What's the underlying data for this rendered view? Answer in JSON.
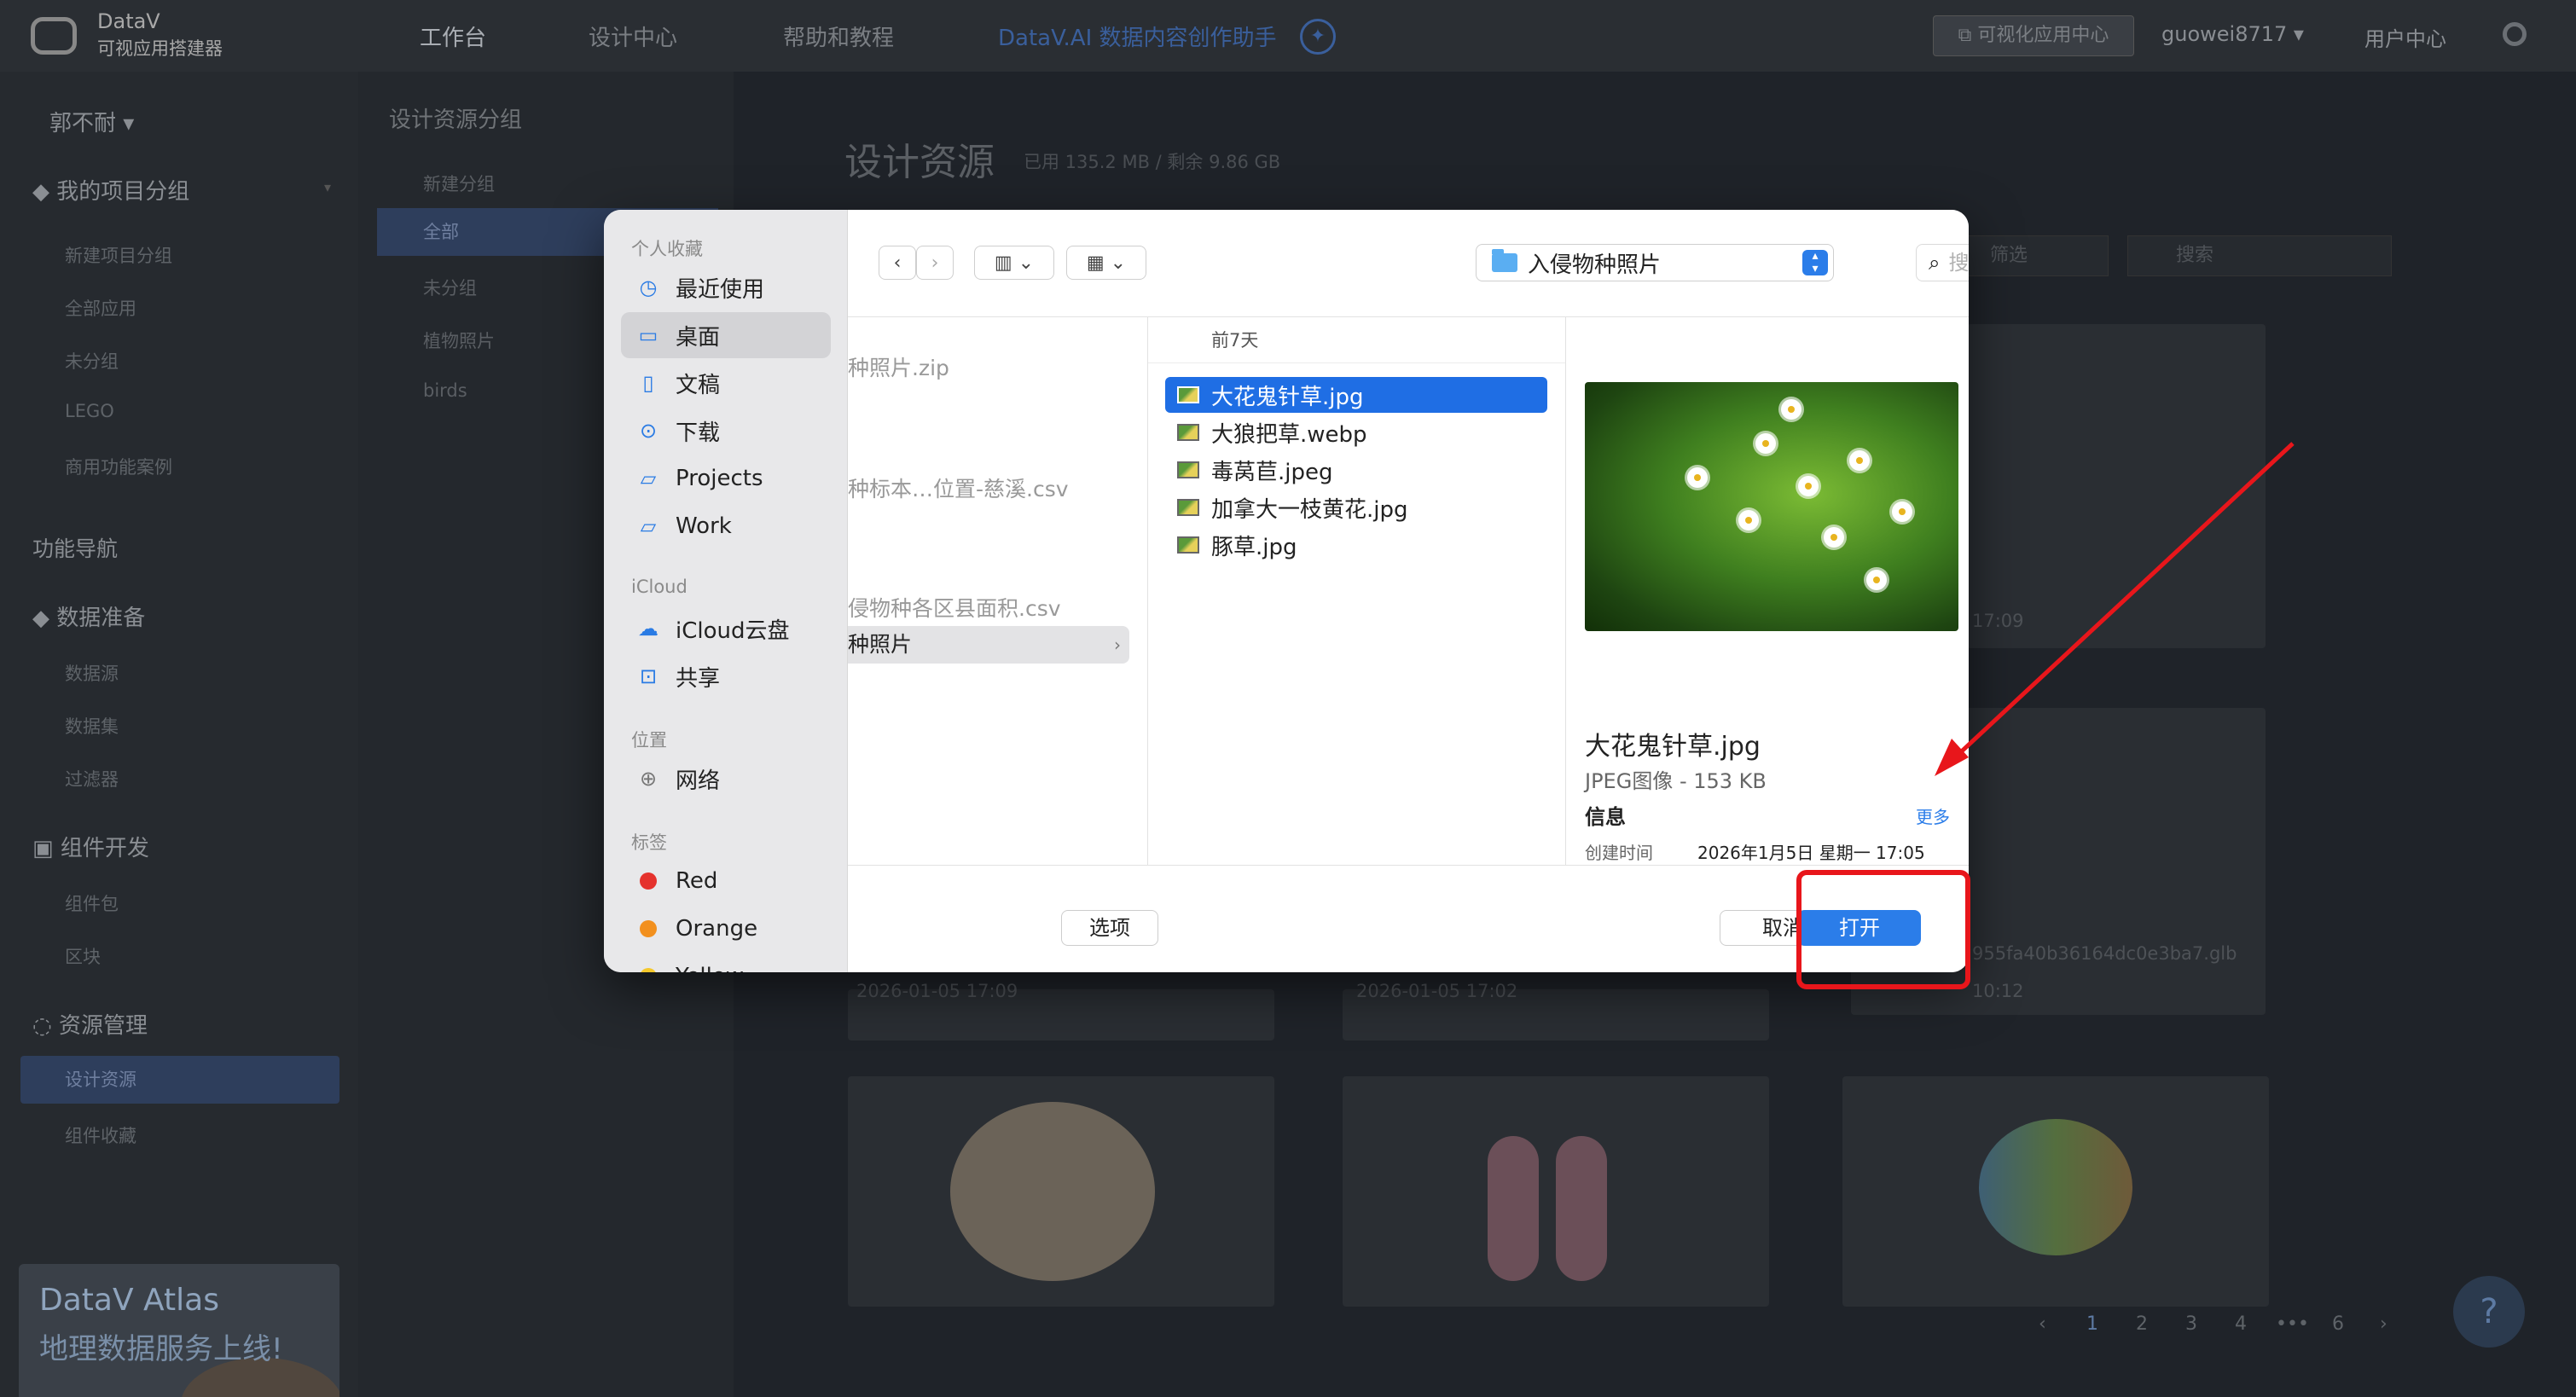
{
  "header": {
    "brand_line1": "DataV",
    "brand_line2": "可视应用搭建器",
    "nav": [
      "工作台",
      "设计中心",
      "帮助和教程",
      "DataV.AI 数据内容创作助手"
    ],
    "app_center": "可视化应用中心",
    "username": "guowei8717 ▾",
    "user_center": "用户中心"
  },
  "left_sidebar": {
    "user": "郭不耐 ▾",
    "project_group_title": "我的项目分组",
    "project_items": [
      "新建项目分组",
      "全部应用",
      "未分组",
      "LEGO",
      "商用功能案例"
    ],
    "function_nav": "功能导航",
    "data_prep": "数据准备",
    "data_items": [
      "数据源",
      "数据集",
      "过滤器"
    ],
    "component_dev": "组件开发",
    "component_items": [
      "组件包",
      "区块"
    ],
    "resource_mgmt": "资源管理",
    "resource_items": [
      "设计资源",
      "组件收藏"
    ],
    "promo_line1": "DataV Atlas",
    "promo_line2": "地理数据服务上线!"
  },
  "group_col": {
    "title": "设计资源分组",
    "items": [
      "新建分组",
      "全部",
      "未分组",
      "植物照片",
      "birds"
    ]
  },
  "main": {
    "title": "设计资源",
    "quota": "已用 135.2 MB / 剩余 9.86 GB",
    "filter": "筛选",
    "search_placeholder": "搜索",
    "card_dates": [
      "2026-01-05 17:09",
      "2026-01-05 17:02",
      "10:12"
    ],
    "card_file": "955fa40b36164dc0e3ba7.glb",
    "card_date_top": "17:09",
    "pages": [
      "1",
      "2",
      "3",
      "4",
      "•••",
      "6"
    ]
  },
  "dialog": {
    "sidebar": {
      "favorites_title": "个人收藏",
      "favorites": [
        {
          "label": "最近使用",
          "icon": "clock-icon"
        },
        {
          "label": "桌面",
          "icon": "desktop-icon"
        },
        {
          "label": "文稿",
          "icon": "document-icon"
        },
        {
          "label": "下载",
          "icon": "download-icon"
        },
        {
          "label": "Projects",
          "icon": "folder-icon"
        },
        {
          "label": "Work",
          "icon": "folder-icon"
        }
      ],
      "icloud_title": "iCloud",
      "icloud": [
        "iCloud云盘",
        "共享"
      ],
      "location_title": "位置",
      "locations": [
        "网络"
      ],
      "tags_title": "标签",
      "tags": [
        {
          "label": "Red",
          "color": "#e5322d"
        },
        {
          "label": "Orange",
          "color": "#f2901e"
        },
        {
          "label": "Yellow",
          "color": "#f5c82b"
        }
      ]
    },
    "toolbar": {
      "back": "‹",
      "forward": "›",
      "location": "入侵物种照片",
      "search_placeholder": "搜索"
    },
    "col1": {
      "items": [
        "种照片.zip",
        "种标本…位置-慈溪.csv",
        "侵物种各区县面积.csv",
        "种照片"
      ]
    },
    "col2": {
      "header": "前7天",
      "files": [
        "大花鬼针草.jpg",
        "大狼把草.webp",
        "毒莴苣.jpeg",
        "加拿大一枝黄花.jpg",
        "豚草.jpg"
      ]
    },
    "preview": {
      "name": "大花鬼针草.jpg",
      "type": "JPEG图像 - 153 KB",
      "info": "信息",
      "more": "更多",
      "created_label": "创建时间",
      "created_value": "2026年1月5日 星期一 17:05"
    },
    "footer": {
      "options": "选项",
      "cancel": "取消",
      "open": "打开"
    }
  },
  "colors": {
    "accent": "#2b7de9",
    "selection": "#1f6ee4",
    "annotation": "#e8161b"
  }
}
